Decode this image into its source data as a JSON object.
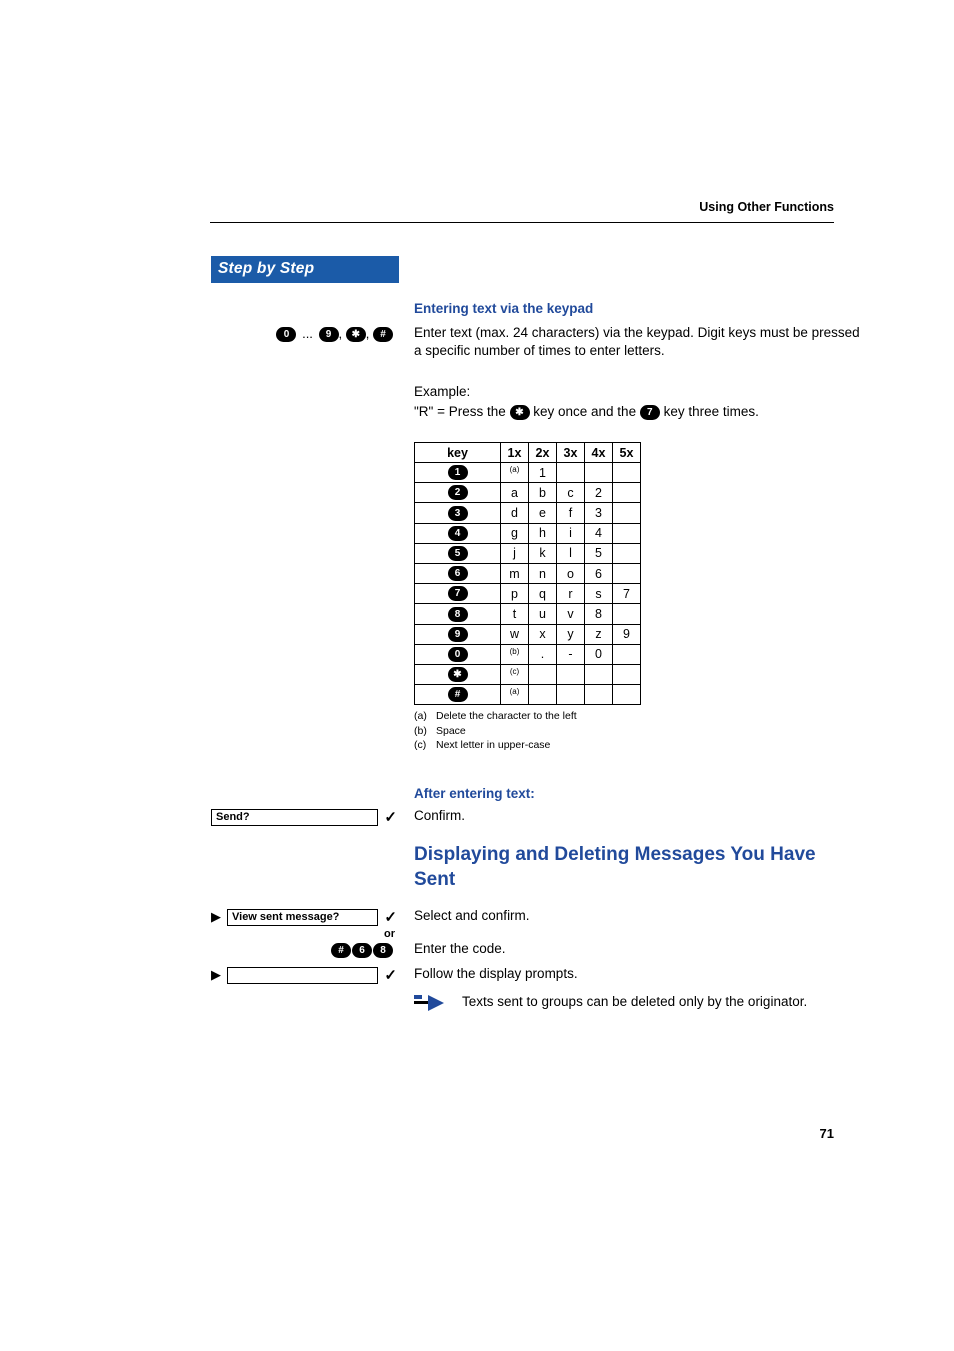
{
  "running_header": "Using Other Functions",
  "sidebar_title": "Step by Step",
  "section1": {
    "heading": "Entering text via the keypad",
    "keys_left": {
      "start": "0",
      "end": "9",
      "sep1": " ... ",
      "comma": ", ",
      "star": "✱",
      "hash": "#"
    },
    "para1": "Enter text (max. 24 characters) via the keypad. Digit keys must be pressed a specific number of times to enter letters.",
    "example_label": "Example:",
    "example_pre": "\"R\" = Press the ",
    "example_key1": "✱",
    "example_mid": " key once and the ",
    "example_key2": "7",
    "example_post": " key three times."
  },
  "chart_data": {
    "type": "table",
    "headers": [
      "key",
      "1x",
      "2x",
      "3x",
      "4x",
      "5x"
    ],
    "rows": [
      {
        "key_label": "1",
        "cells": [
          "(a)",
          "1",
          "",
          "",
          ""
        ]
      },
      {
        "key_label": "2",
        "cells": [
          "a",
          "b",
          "c",
          "2",
          ""
        ]
      },
      {
        "key_label": "3",
        "cells": [
          "d",
          "e",
          "f",
          "3",
          ""
        ]
      },
      {
        "key_label": "4",
        "cells": [
          "g",
          "h",
          "i",
          "4",
          ""
        ]
      },
      {
        "key_label": "5",
        "cells": [
          "j",
          "k",
          "l",
          "5",
          ""
        ]
      },
      {
        "key_label": "6",
        "cells": [
          "m",
          "n",
          "o",
          "6",
          ""
        ]
      },
      {
        "key_label": "7",
        "cells": [
          "p",
          "q",
          "r",
          "s",
          "7"
        ]
      },
      {
        "key_label": "8",
        "cells": [
          "t",
          "u",
          "v",
          "8",
          ""
        ]
      },
      {
        "key_label": "9",
        "cells": [
          "w",
          "x",
          "y",
          "z",
          "9"
        ]
      },
      {
        "key_label": "0",
        "cells": [
          "(b)",
          ".",
          "-",
          "0",
          ""
        ]
      },
      {
        "key_label": "✱",
        "cells": [
          "(c)",
          "",
          "",
          "",
          ""
        ]
      },
      {
        "key_label": "#",
        "cells": [
          "(a)",
          "",
          "",
          "",
          ""
        ]
      }
    ],
    "footnotes": [
      {
        "mark": "(a)",
        "text": "Delete the character to the left"
      },
      {
        "mark": "(b)",
        "text": "Space"
      },
      {
        "mark": "(c)",
        "text": "Next letter in upper-case"
      }
    ]
  },
  "section2": {
    "heading": "After entering text:",
    "display": "Send?",
    "confirm": "Confirm."
  },
  "section3": {
    "heading": "Displaying and Deleting Messages You Have Sent",
    "display": "View sent message?",
    "select_confirm": "Select and confirm.",
    "or_label": "or",
    "code_keys": [
      "#",
      "6",
      "8"
    ],
    "enter_code": "Enter the code.",
    "follow_prompts": "Follow the display prompts.",
    "note": "Texts sent to groups can be deleted only by the originator."
  },
  "page_number": "71"
}
